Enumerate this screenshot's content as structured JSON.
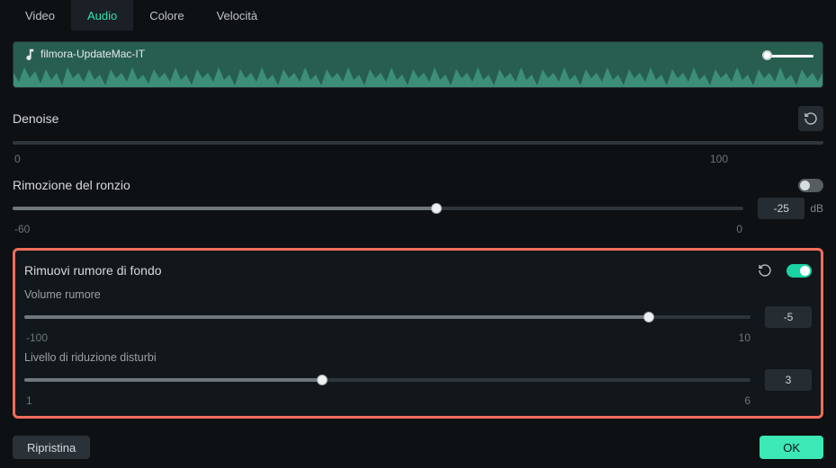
{
  "tabs": {
    "video": "Video",
    "audio": "Audio",
    "color": "Colore",
    "speed": "Velocità",
    "active": "audio"
  },
  "track": {
    "name": "filmora-UpdateMac-IT"
  },
  "denoise": {
    "title": "Denoise",
    "slider": {
      "min": "0",
      "max": "100",
      "percent": 0
    }
  },
  "hum": {
    "title": "Rimozione del ronzio",
    "enabled": false,
    "slider": {
      "min": "-60",
      "max": "0",
      "percent": 58
    },
    "value": "-25",
    "unit": "dB"
  },
  "bgnoise": {
    "title": "Rimuovi rumore di fondo",
    "enabled": true,
    "volume": {
      "label": "Volume rumore",
      "min": "-100",
      "max": "10",
      "percent": 86,
      "value": "-5"
    },
    "level": {
      "label": "Livello di riduzione disturbi",
      "min": "1",
      "max": "6",
      "percent": 41,
      "value": "3"
    }
  },
  "footer": {
    "reset": "Ripristina",
    "ok": "OK"
  }
}
